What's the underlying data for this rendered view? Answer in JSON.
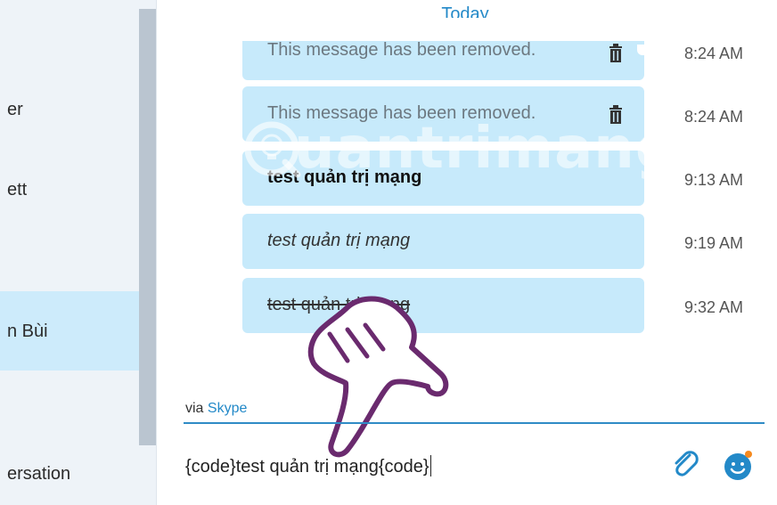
{
  "sidebar": {
    "items": [
      {
        "label": "er"
      },
      {
        "label": "ett"
      },
      {
        "label": "n Bùi"
      },
      {
        "label": "ersation"
      }
    ]
  },
  "chat": {
    "day_label": "Today",
    "messages": [
      {
        "text": "This message has been removed.",
        "time": "8:24 AM",
        "style": "removed"
      },
      {
        "text": "This message has been removed.",
        "time": "8:24 AM",
        "style": "removed"
      },
      {
        "text": "test quản trị mạng",
        "time": "9:13 AM",
        "style": "bold"
      },
      {
        "text": "test quản trị mạng",
        "time": "9:19 AM",
        "style": "italic"
      },
      {
        "text": "test quản trị mạng",
        "time": "9:32 AM",
        "style": "strikethrough"
      }
    ]
  },
  "watermark": {
    "text": "uantrimang"
  },
  "compose": {
    "via_prefix": "via",
    "via_link": "Skype",
    "input_value": "{code}test quản trị mạng{code}"
  },
  "colors": {
    "accent": "#2389c8",
    "bubble": "#c7eafb",
    "selected": "#cdebfb",
    "sidebar_bg": "#eef3f8"
  },
  "icons": [
    "trash-icon",
    "paperclip-icon",
    "emoticon-icon",
    "hand-pointer-icon",
    "bulb-logo-icon"
  ]
}
